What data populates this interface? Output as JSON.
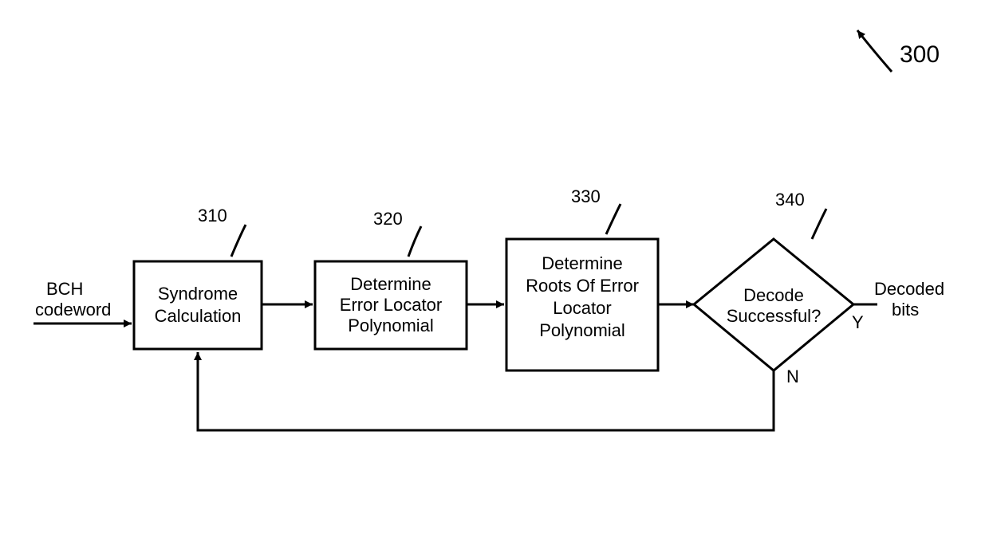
{
  "chart_data": {
    "type": "flowchart",
    "title_ref": "300",
    "nodes": [
      {
        "id": "input",
        "type": "io",
        "text": "BCH codeword"
      },
      {
        "id": "n310",
        "type": "process",
        "ref": "310",
        "lines": [
          "Syndrome",
          "Calculation"
        ]
      },
      {
        "id": "n320",
        "type": "process",
        "ref": "320",
        "lines": [
          "Determine",
          "Error Locator",
          "Polynomial"
        ]
      },
      {
        "id": "n330",
        "type": "process",
        "ref": "330",
        "lines": [
          "Determine",
          "Roots Of Error",
          "Locator",
          "Polynomial"
        ]
      },
      {
        "id": "n340",
        "type": "decision",
        "ref": "340",
        "lines": [
          "Decode",
          "Successful?"
        ]
      },
      {
        "id": "output",
        "type": "io",
        "text_lines": [
          "Decoded",
          "bits"
        ]
      }
    ],
    "edges": [
      {
        "from": "input",
        "to": "n310"
      },
      {
        "from": "n310",
        "to": "n320"
      },
      {
        "from": "n320",
        "to": "n330"
      },
      {
        "from": "n330",
        "to": "n340"
      },
      {
        "from": "n340",
        "to": "output",
        "label": "Y"
      },
      {
        "from": "n340",
        "to": "n310",
        "label": "N",
        "feedback": true
      }
    ]
  },
  "diagram": {
    "title_ref": "300",
    "input_l1": "BCH",
    "input_l2": "codeword",
    "b310_ref": "310",
    "b310_l1": "Syndrome",
    "b310_l2": "Calculation",
    "b320_ref": "320",
    "b320_l1": "Determine",
    "b320_l2": "Error Locator",
    "b320_l3": "Polynomial",
    "b330_ref": "330",
    "b330_l1": "Determine",
    "b330_l2": "Roots Of Error",
    "b330_l3": "Locator",
    "b330_l4": "Polynomial",
    "d340_ref": "340",
    "d340_l1": "Decode",
    "d340_l2": "Successful?",
    "yes": "Y",
    "no": "N",
    "out_l1": "Decoded",
    "out_l2": "bits"
  }
}
